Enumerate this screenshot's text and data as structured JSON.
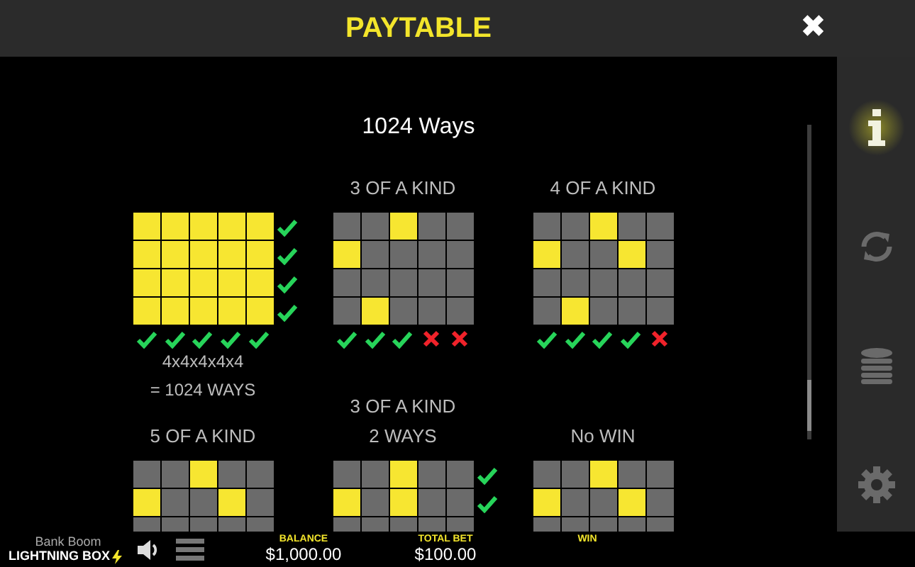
{
  "header": {
    "title": "PAYTABLE",
    "close": "✖"
  },
  "sections": [
    {
      "heading": "1024 Ways",
      "examples": [
        {
          "cells": [
            [
              true,
              true,
              true,
              true,
              true
            ],
            [
              true,
              true,
              true,
              true,
              true
            ],
            [
              true,
              true,
              true,
              true,
              true
            ],
            [
              true,
              true,
              true,
              true,
              true
            ]
          ],
          "row_marks": [
            true,
            true,
            true,
            true
          ],
          "reel_marks": [
            true,
            true,
            true,
            true,
            true
          ],
          "notes": [
            "4x4x4x4x4",
            "= 1024 WAYS"
          ]
        },
        {
          "labels": [
            "3 OF A KIND"
          ],
          "cells": [
            [
              false,
              false,
              true,
              false,
              false
            ],
            [
              true,
              false,
              false,
              false,
              false
            ],
            [
              false,
              false,
              false,
              false,
              false
            ],
            [
              false,
              true,
              false,
              false,
              false
            ]
          ],
          "reel_marks": [
            true,
            true,
            true,
            false,
            false
          ]
        },
        {
          "labels": [
            "4 OF A KIND"
          ],
          "cells": [
            [
              false,
              false,
              true,
              false,
              false
            ],
            [
              true,
              false,
              false,
              true,
              false
            ],
            [
              false,
              false,
              false,
              false,
              false
            ],
            [
              false,
              true,
              false,
              false,
              false
            ]
          ],
          "reel_marks": [
            true,
            true,
            true,
            true,
            false
          ]
        }
      ]
    },
    {
      "examples": [
        {
          "labels": [
            "5 OF A KIND"
          ],
          "cells": [
            [
              false,
              false,
              true,
              false,
              false
            ],
            [
              true,
              false,
              false,
              true,
              false
            ],
            [
              false,
              false,
              false,
              false,
              false
            ]
          ]
        },
        {
          "labels": [
            "3 OF A KIND",
            "2 WAYS"
          ],
          "cells": [
            [
              false,
              false,
              true,
              false,
              false
            ],
            [
              true,
              false,
              true,
              false,
              false
            ],
            [
              false,
              false,
              false,
              false,
              false
            ]
          ],
          "row_marks": [
            true,
            true
          ]
        },
        {
          "labels": [
            "No WIN"
          ],
          "cells": [
            [
              false,
              false,
              true,
              false,
              false
            ],
            [
              true,
              false,
              false,
              true,
              false
            ],
            [
              false,
              false,
              false,
              false,
              false
            ]
          ]
        }
      ]
    }
  ],
  "sidebar": [
    {
      "kind": "info",
      "selected": true
    },
    {
      "kind": "refresh",
      "selected": false
    },
    {
      "kind": "coins",
      "selected": false
    },
    {
      "kind": "settings",
      "selected": false
    }
  ],
  "footer": {
    "game": "Bank Boom",
    "brand": "LIGHTNING BOX",
    "meters": [
      {
        "label": "BALANCE",
        "value": "$1,000.00"
      },
      {
        "label": "TOTAL BET",
        "value": "$100.00"
      },
      {
        "label": "WIN"
      }
    ]
  }
}
